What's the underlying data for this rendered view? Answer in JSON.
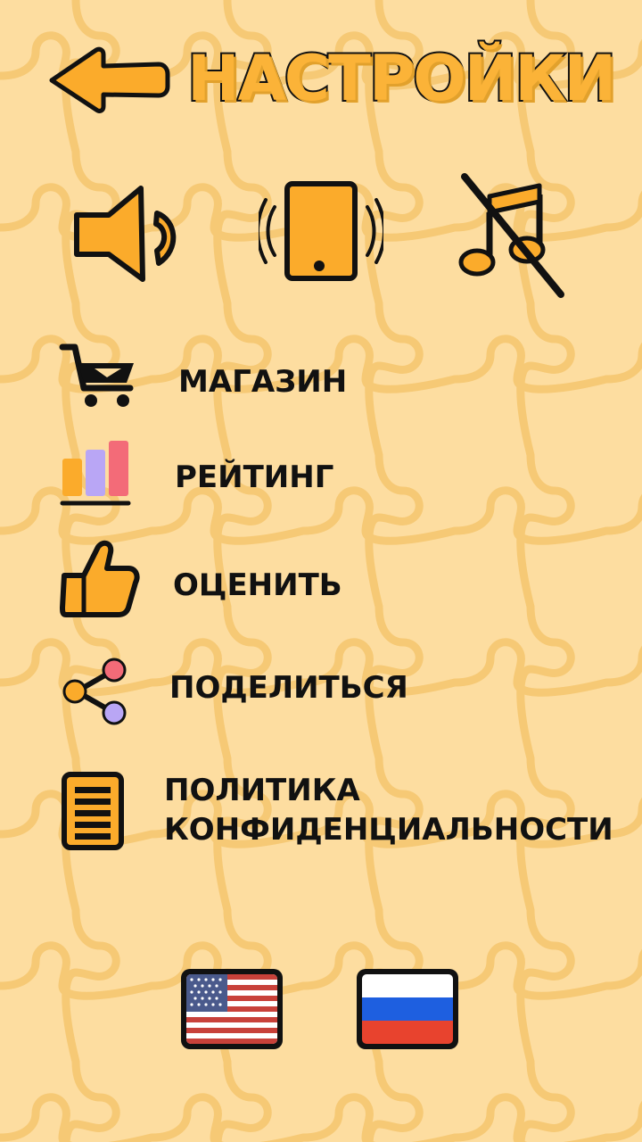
{
  "header": {
    "back_icon": "arrow-left-icon",
    "title": "НАСТРОЙКИ"
  },
  "toggles": {
    "sound": {
      "icon": "speaker-icon",
      "state": "on"
    },
    "vibration": {
      "icon": "vibration-icon",
      "state": "on"
    },
    "music": {
      "icon": "music-note-off-icon",
      "state": "off"
    }
  },
  "menu": {
    "shop": {
      "icon": "cart-icon",
      "label": "МАГАЗИН"
    },
    "rating": {
      "icon": "leaderboard-icon",
      "label": "РЕЙТИНГ"
    },
    "rate": {
      "icon": "thumbs-up-icon",
      "label": "ОЦЕНИТЬ"
    },
    "share": {
      "icon": "share-icon",
      "label": "ПОДЕЛИТЬСЯ"
    },
    "policy": {
      "icon": "document-icon",
      "label_line1": "ПОЛИТИКА",
      "label_line2": "КОНФИДЕНЦИАЛЬНОСТИ"
    }
  },
  "languages": [
    {
      "code": "en",
      "icon": "us-flag-icon"
    },
    {
      "code": "ru",
      "icon": "russia-flag-icon"
    }
  ],
  "colors": {
    "background": "#fddda0",
    "accent_orange": "#fbab2b",
    "puzzle_lines": "#f6c46f",
    "outline": "#111111"
  }
}
